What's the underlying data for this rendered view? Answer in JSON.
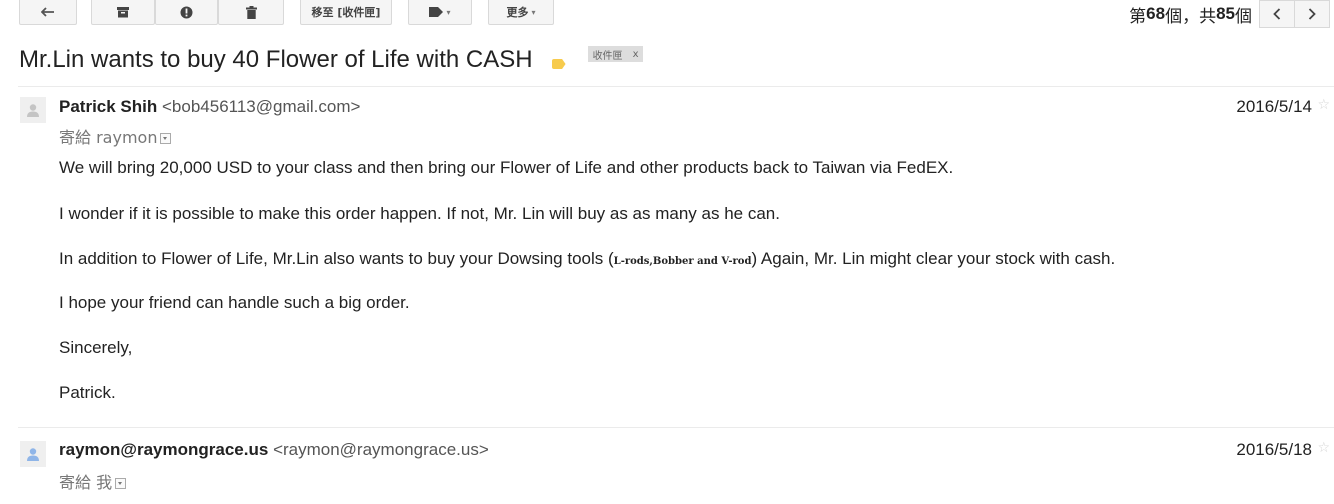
{
  "toolbar": {
    "back_icon": "back-arrow-icon",
    "archive_icon": "archive-icon",
    "spam_icon": "report-spam-icon",
    "delete_icon": "trash-icon",
    "move_to_label": "移至 [收件匣]",
    "labels_icon": "label-tag-icon",
    "more_label": "更多",
    "caret": "▾"
  },
  "pager": {
    "prefix": "第 ",
    "current": "68",
    "mid": " 個，共 ",
    "total": "85",
    "suffix": " 個",
    "prev_icon": "chevron-left-icon",
    "next_icon": "chevron-right-icon"
  },
  "subject": {
    "text": "Mr.Lin wants to buy 40 Flower of Life with CASH",
    "label_chip": "收件匣",
    "label_remove": "x",
    "label_color": "#f7cb4d"
  },
  "messages": [
    {
      "sender_name": "Patrick Shih",
      "sender_email": "<bob456113@gmail.com>",
      "date": "2016/5/14",
      "star": "☆",
      "to": "寄給 raymon",
      "body": {
        "p1": "We will bring 20,000 USD to your class and then bring our Flower of Life and other products back to Taiwan via FedEX.",
        "p2": "I wonder if it is possible to make this order happen. If not, Mr. Lin will buy as as many as he can.",
        "p3_a": "In addition to Flower of Life, Mr.Lin also wants to buy your Dowsing tools (",
        "p3_b": "L-rods,Bobber and V-rod",
        "p3_c": ")  Again, Mr. Lin might clear your stock with cash.",
        "p4": "I hope your friend can handle such a big order.",
        "p5": "Sincerely,",
        "p6": "Patrick."
      }
    },
    {
      "sender_name": "raymon@raymongrace.us",
      "sender_email": "<raymon@raymongrace.us>",
      "date": "2016/5/18",
      "star": "☆",
      "to": "寄給 我"
    }
  ]
}
